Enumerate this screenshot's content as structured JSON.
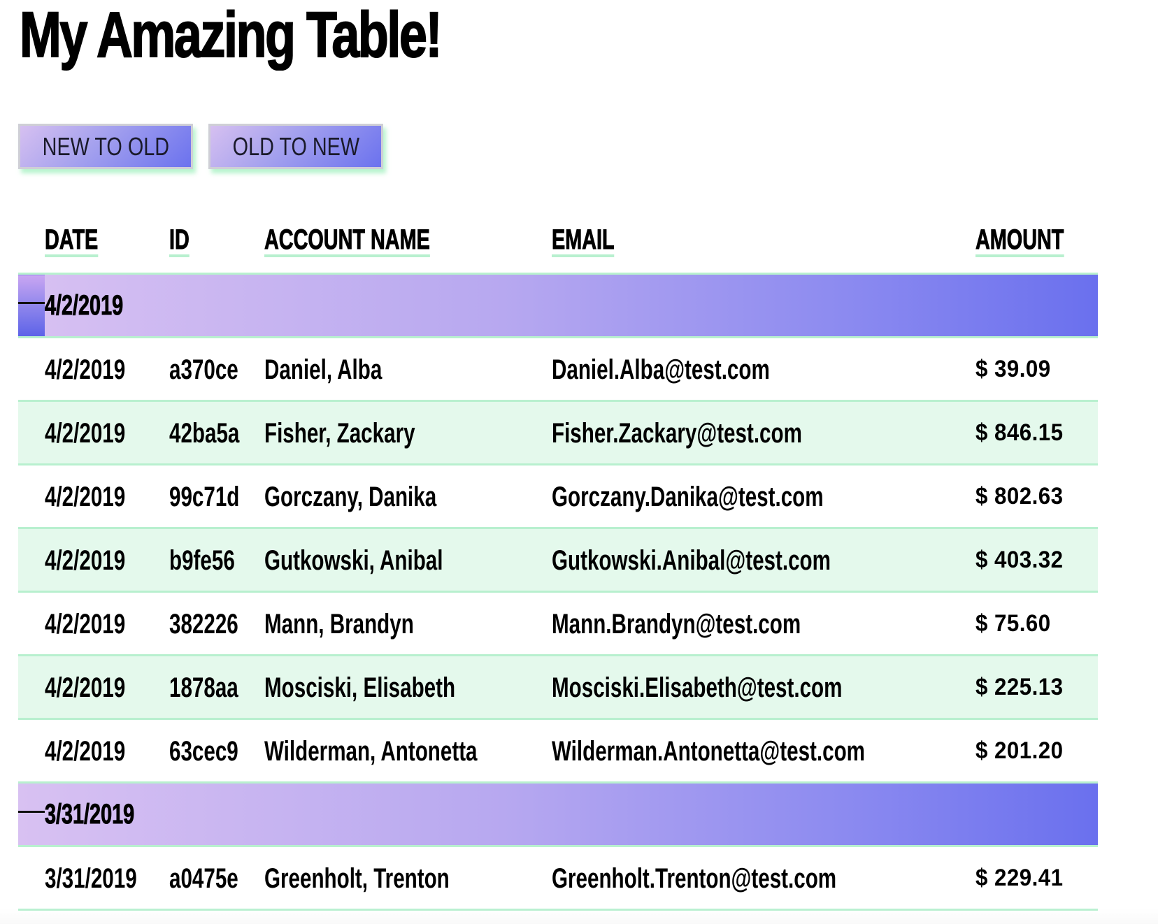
{
  "page": {
    "title": "My Amazing Table!"
  },
  "sort_buttons": {
    "new_to_old": "NEW TO OLD",
    "old_to_new": "OLD TO NEW"
  },
  "table": {
    "columns": [
      "DATE",
      "ID",
      "ACCOUNT NAME",
      "EMAIL",
      "AMOUNT"
    ],
    "groups": [
      {
        "date": "4/2/2019",
        "toggle_icon": "minus-icon",
        "expanded": true,
        "rows": [
          {
            "date": "4/2/2019",
            "id": "a370ce",
            "name": "Daniel, Alba",
            "email": "Daniel.Alba@test.com",
            "amount": "$ 39.09"
          },
          {
            "date": "4/2/2019",
            "id": "42ba5a",
            "name": "Fisher, Zackary",
            "email": "Fisher.Zackary@test.com",
            "amount": "$ 846.15"
          },
          {
            "date": "4/2/2019",
            "id": "99c71d",
            "name": "Gorczany, Danika",
            "email": "Gorczany.Danika@test.com",
            "amount": "$ 802.63"
          },
          {
            "date": "4/2/2019",
            "id": "b9fe56",
            "name": "Gutkowski, Anibal",
            "email": "Gutkowski.Anibal@test.com",
            "amount": "$ 403.32"
          },
          {
            "date": "4/2/2019",
            "id": "382226",
            "name": "Mann, Brandyn",
            "email": "Mann.Brandyn@test.com",
            "amount": "$ 75.60"
          },
          {
            "date": "4/2/2019",
            "id": "1878aa",
            "name": "Mosciski, Elisabeth",
            "email": "Mosciski.Elisabeth@test.com",
            "amount": "$ 225.13"
          },
          {
            "date": "4/2/2019",
            "id": "63cec9",
            "name": "Wilderman, Antonetta",
            "email": "Wilderman.Antonetta@test.com",
            "amount": "$ 201.20"
          }
        ]
      },
      {
        "date": "3/31/2019",
        "toggle_icon": "minus-icon",
        "expanded": true,
        "rows": [
          {
            "date": "3/31/2019",
            "id": "a0475e",
            "name": "Greenholt, Trenton",
            "email": "Greenholt.Trenton@test.com",
            "amount": "$ 229.41"
          }
        ]
      }
    ]
  },
  "colors": {
    "accent_green": "#b8f0cf",
    "row_alt_bg": "#e4f9ec",
    "gradient_start": "#d8c1f2",
    "gradient_end": "#6a70ee"
  }
}
